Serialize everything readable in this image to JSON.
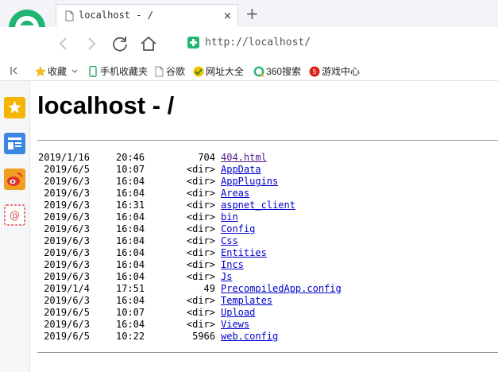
{
  "tab": {
    "title": "localhost - /",
    "close": "×",
    "new_tab": "+"
  },
  "nav": {
    "url": "http://localhost/"
  },
  "bookmarks": [
    {
      "label": "收藏",
      "icon": "star-icon"
    },
    {
      "label": "手机收藏夹",
      "icon": "phone-icon"
    },
    {
      "label": "谷歌",
      "icon": "document-icon"
    },
    {
      "label": "网址大全",
      "icon": "wangzhi-icon"
    },
    {
      "label": "360搜索",
      "icon": "search360-icon"
    },
    {
      "label": "游戏中心",
      "icon": "game-center-icon"
    }
  ],
  "colors": {
    "accent": "#21b573",
    "link": "#0000cc",
    "visited": "#551a8b"
  },
  "page": {
    "heading": "localhost - /",
    "entries": [
      {
        "date": "2019/1/16",
        "time": "20:46",
        "size": "704",
        "name": "404.html"
      },
      {
        "date": "2019/6/5",
        "time": "10:07",
        "size": "<dir>",
        "name": "AppData"
      },
      {
        "date": "2019/6/3",
        "time": "16:04",
        "size": "<dir>",
        "name": "AppPlugins"
      },
      {
        "date": "2019/6/3",
        "time": "16:04",
        "size": "<dir>",
        "name": "Areas"
      },
      {
        "date": "2019/6/3",
        "time": "16:31",
        "size": "<dir>",
        "name": "aspnet_client"
      },
      {
        "date": "2019/6/3",
        "time": "16:04",
        "size": "<dir>",
        "name": "bin"
      },
      {
        "date": "2019/6/3",
        "time": "16:04",
        "size": "<dir>",
        "name": "Config"
      },
      {
        "date": "2019/6/3",
        "time": "16:04",
        "size": "<dir>",
        "name": "Css"
      },
      {
        "date": "2019/6/3",
        "time": "16:04",
        "size": "<dir>",
        "name": "Entities"
      },
      {
        "date": "2019/6/3",
        "time": "16:04",
        "size": "<dir>",
        "name": "Incs"
      },
      {
        "date": "2019/6/3",
        "time": "16:04",
        "size": "<dir>",
        "name": "Js"
      },
      {
        "date": "2019/1/4",
        "time": "17:51",
        "size": "49",
        "name": "PrecompiledApp.config"
      },
      {
        "date": "2019/6/3",
        "time": "16:04",
        "size": "<dir>",
        "name": "Templates"
      },
      {
        "date": "2019/6/5",
        "time": "10:07",
        "size": "<dir>",
        "name": "Upload"
      },
      {
        "date": "2019/6/3",
        "time": "16:04",
        "size": "<dir>",
        "name": "Views"
      },
      {
        "date": "2019/6/5",
        "time": "10:22",
        "size": "5966",
        "name": "web.config"
      }
    ]
  }
}
